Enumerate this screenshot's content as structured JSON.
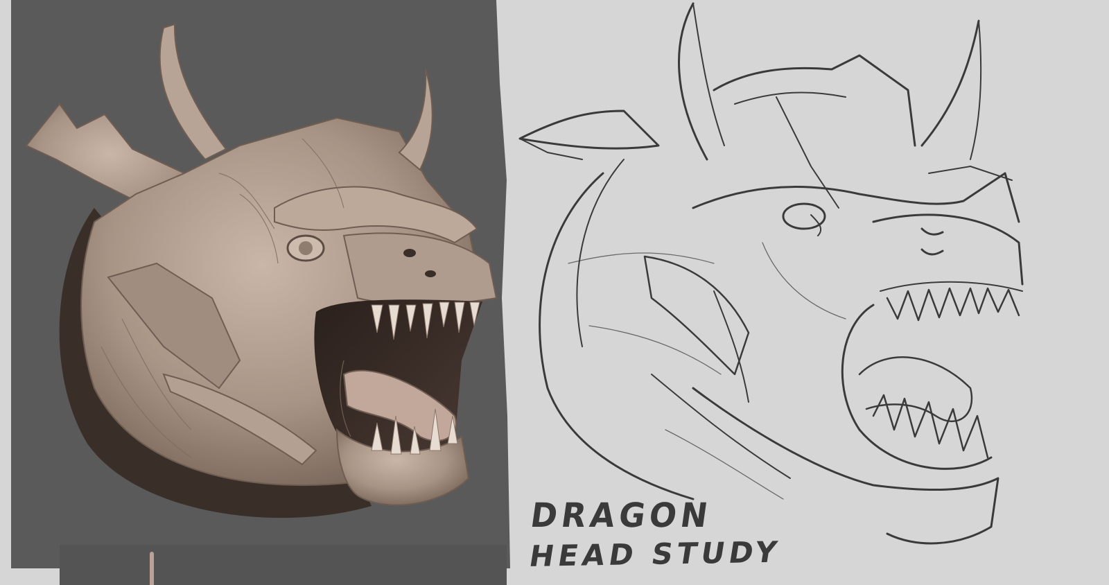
{
  "artwork": {
    "caption_line1": "DRAGON",
    "caption_line2": "HEAD STUDY"
  },
  "colors": {
    "canvas_background": "#d6d6d6",
    "render_background": "#5a5a5a",
    "sculpt_skin": "#a89485",
    "sculpt_shadow": "#3a2e29",
    "sketch_line": "#3a3a3a"
  },
  "panels": {
    "left": "3D sculpt render",
    "right": "pencil sketch"
  }
}
